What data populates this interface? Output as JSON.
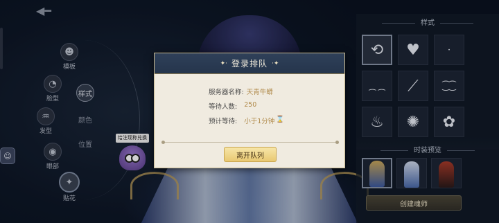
{
  "left_nav": {
    "items": [
      {
        "label": "模板",
        "icon": "person-icon"
      },
      {
        "label": "脸型",
        "icon": "face-icon"
      },
      {
        "label": "发型",
        "icon": "hair-icon"
      },
      {
        "label": "眼部",
        "icon": "eye-icon"
      },
      {
        "label": "贴花",
        "icon": "decal-icon"
      }
    ],
    "sub_items": [
      {
        "label": "样式",
        "selected": true
      },
      {
        "label": "颜色"
      },
      {
        "label": "位置"
      }
    ]
  },
  "nickname_bubble": "给注现称兑换",
  "right_panel": {
    "style_title": "样式",
    "style_icons": [
      "refresh-icon",
      "heart-icon",
      "dot-icon",
      "curve-marks-icon",
      "slash-icon",
      "lashes-icon",
      "flame-icon",
      "swirl-icon",
      "flower-icon"
    ],
    "costume_title": "时装预览",
    "create_button": "创建魂师"
  },
  "dialog": {
    "title": "登录排队",
    "rows": [
      {
        "label": "服务器名称:",
        "value": "天青牛蟒"
      },
      {
        "label": "等待人数:",
        "value": "250"
      },
      {
        "label": "预计等待:",
        "value": "小于1分钟",
        "icon": "hourglass-icon"
      }
    ],
    "leave_button": "离开队列"
  },
  "colors": {
    "dialog_header": "#2f4059",
    "accent_gold": "#b08a4a",
    "button_gold": "#e8c872"
  }
}
